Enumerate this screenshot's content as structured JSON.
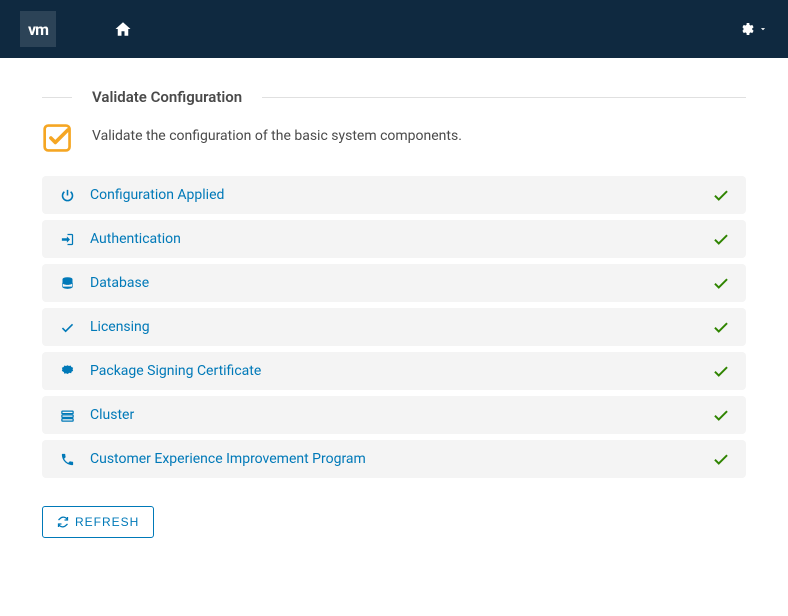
{
  "logo": "vm",
  "section": {
    "title": "Validate Configuration",
    "description": "Validate the configuration of the basic system components."
  },
  "items": [
    {
      "label": "Configuration Applied"
    },
    {
      "label": "Authentication"
    },
    {
      "label": "Database"
    },
    {
      "label": "Licensing"
    },
    {
      "label": "Package Signing Certificate"
    },
    {
      "label": "Cluster"
    },
    {
      "label": "Customer Experience Improvement Program"
    }
  ],
  "refresh_label": "REFRESH"
}
